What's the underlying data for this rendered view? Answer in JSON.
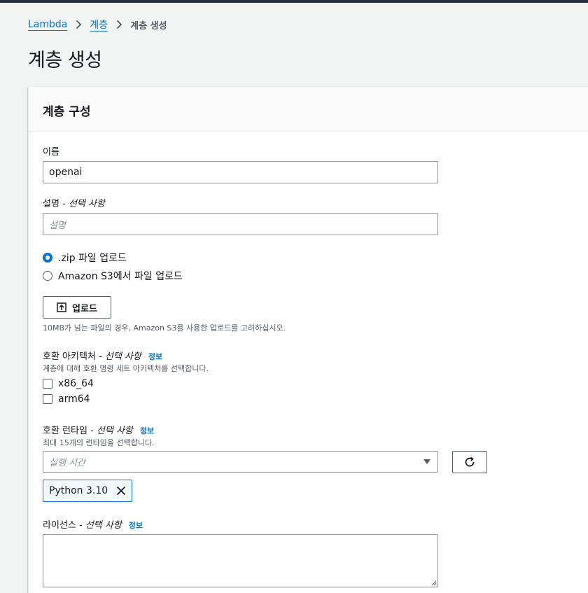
{
  "breadcrumb": {
    "items": [
      {
        "label": "Lambda"
      },
      {
        "label": "계층"
      }
    ],
    "current": "계층 생성"
  },
  "page": {
    "title": "계층 생성"
  },
  "panel": {
    "title": "계층 구성",
    "name_field": {
      "label": "이름",
      "value": "openai"
    },
    "description_field": {
      "label": "설명",
      "optional": "선택 사항",
      "placeholder": "설명"
    },
    "upload_options": [
      {
        "label": ".zip 파일 업로드",
        "selected": true
      },
      {
        "label": "Amazon S3에서 파일 업로드",
        "selected": false
      }
    ],
    "upload_button": "업로드",
    "upload_hint": "10MB가 넘는 파일의 경우, Amazon S3를 사용한 업로드를 고려하십시오.",
    "architecture": {
      "label": "호환 아키텍처",
      "optional": "선택 사항",
      "info": "정보",
      "hint": "계층에 대해 호환 명령 세트 아키텍처를 선택합니다.",
      "options": [
        {
          "label": "x86_64",
          "checked": false
        },
        {
          "label": "arm64",
          "checked": false
        }
      ]
    },
    "runtime": {
      "label": "호환 런타임",
      "optional": "선택 사항",
      "info": "정보",
      "hint": "최대 15개의 런타임을 선택합니다.",
      "placeholder": "실행 시간",
      "selected_tokens": [
        "Python 3.10"
      ]
    },
    "license": {
      "label": "라이선스",
      "optional": "선택 사항",
      "info": "정보",
      "value": ""
    }
  },
  "colors": {
    "accent": "#0972d3",
    "topbar": "#232f3e",
    "background": "#f2f3f3"
  }
}
